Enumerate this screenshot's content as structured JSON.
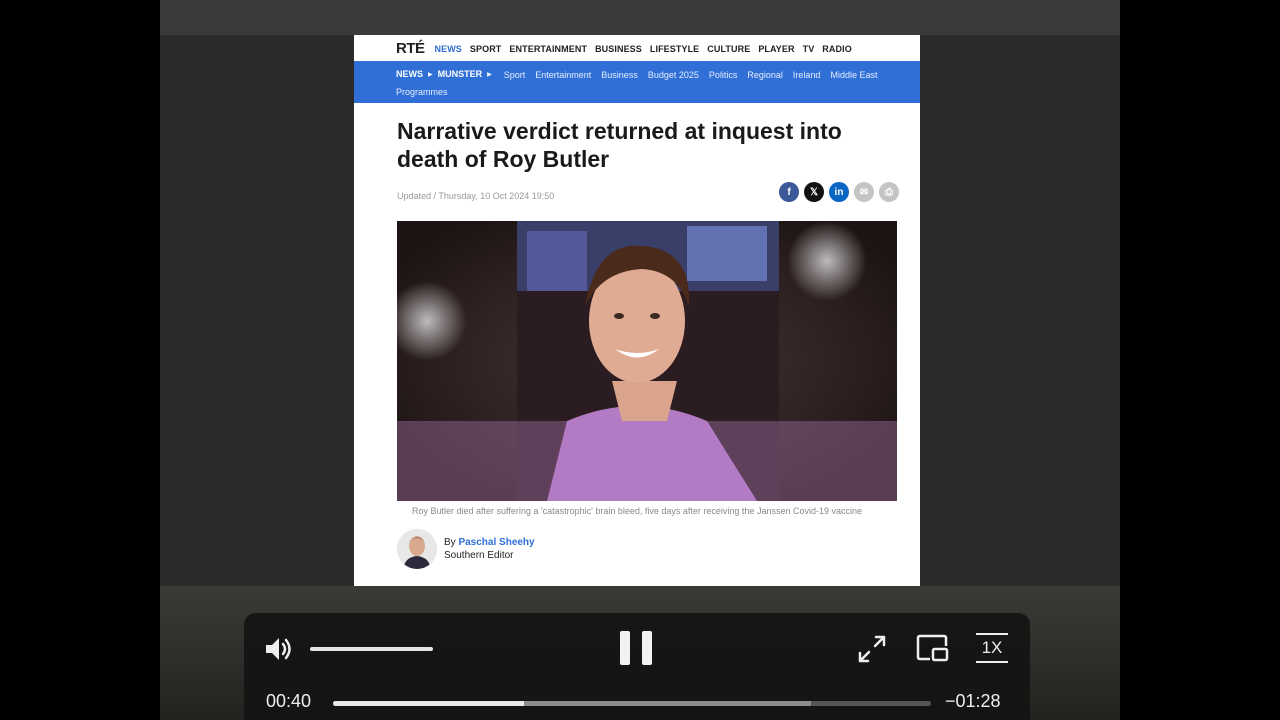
{
  "article": {
    "logo": "RTÉ",
    "top_nav": [
      "NEWS",
      "SPORT",
      "ENTERTAINMENT",
      "BUSINESS",
      "LIFESTYLE",
      "CULTURE",
      "PLAYER",
      "TV",
      "RADIO"
    ],
    "breadcrumb": {
      "section": "NEWS",
      "region": "MUNSTER"
    },
    "sub_nav": [
      "Sport",
      "Entertainment",
      "Business",
      "Budget 2025",
      "Politics",
      "Regional",
      "Ireland",
      "Middle East"
    ],
    "sub_nav_row2": "Programmes",
    "headline": "Narrative verdict returned at inquest into death of Roy Butler",
    "updated": "Updated / Thursday, 10 Oct 2024 19:50",
    "share_icons": [
      "facebook-icon",
      "x-icon",
      "linkedin-icon",
      "email-icon",
      "print-icon"
    ],
    "share_glyphs": {
      "facebook": "f",
      "x": "𝕏",
      "linkedin": "in",
      "email": "✉",
      "print": "⎙"
    },
    "caption": "Roy Butler died after suffering a 'catastrophic' brain bleed, five days after receiving the Janssen Covid-19 vaccine",
    "byline_prefix": "By",
    "author": "Paschal Sheehy",
    "author_role": "Southern Editor",
    "colors": {
      "brand_blue": "#2f6fd6",
      "facebook": "#3b5998",
      "x": "#111111",
      "linkedin": "#0a66c2",
      "email": "#bdbdbd",
      "print": "#bdbdbd"
    }
  },
  "player": {
    "current_time": "00:40",
    "remaining_time": "−01:28",
    "speed": "1X",
    "progress_fraction": 0.32,
    "buffered_fraction": 0.8,
    "volume_fraction": 1.0,
    "icons": [
      "volume-icon",
      "pause-icon",
      "expand-icon",
      "picture-in-picture-icon",
      "playback-speed-icon"
    ]
  }
}
